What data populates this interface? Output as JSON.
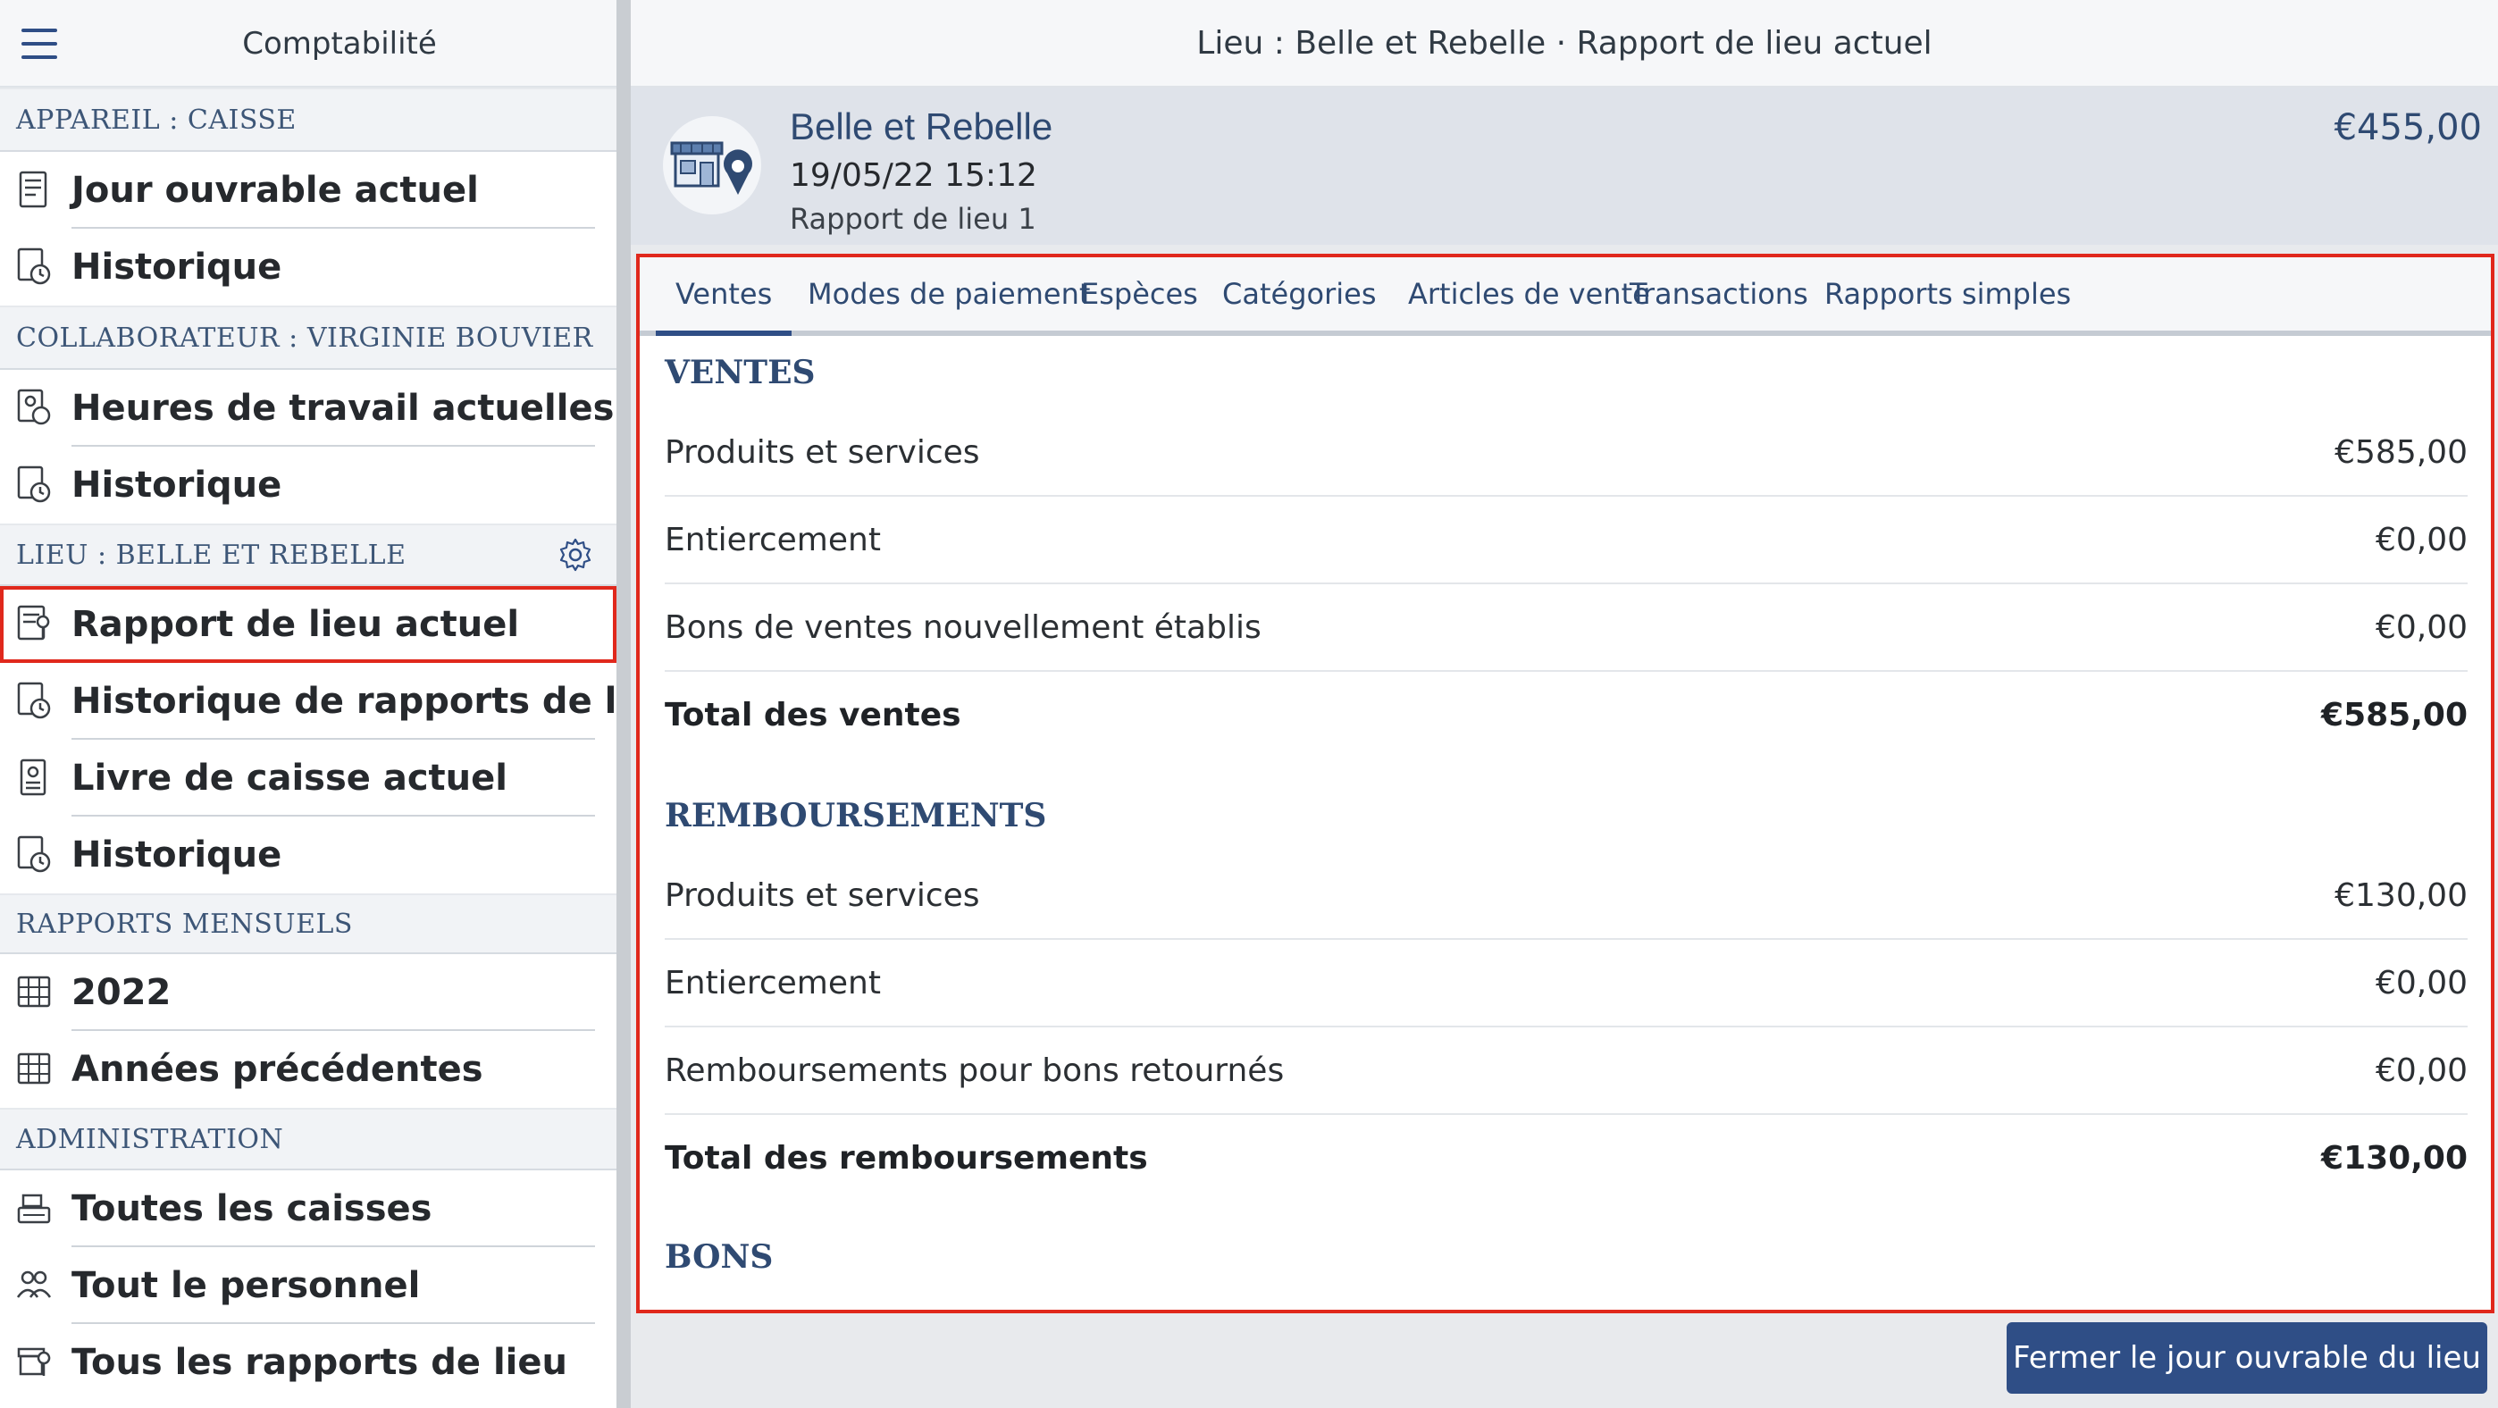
{
  "sidebar": {
    "title": "Comptabilité",
    "sections": [
      {
        "title": "APPAREIL : CAISSE",
        "items": [
          {
            "label": "Jour ouvrable actuel",
            "icon": "receipt-icon"
          },
          {
            "label": "Historique",
            "icon": "history-icon"
          }
        ]
      },
      {
        "title": "COLLABORATEUR : VIRGINIE BOUVIER",
        "items": [
          {
            "label": "Heures de travail actuelles",
            "icon": "work-hours-icon"
          },
          {
            "label": "Historique",
            "icon": "history-icon"
          }
        ]
      },
      {
        "title": "LIEU : BELLE ET REBELLE",
        "items": [
          {
            "label": "Rapport de lieu actuel",
            "icon": "venue-report-icon"
          },
          {
            "label": "Historique de rapports de lieu",
            "icon": "history-icon"
          },
          {
            "label": "Livre de caisse actuel",
            "icon": "cash-book-icon"
          },
          {
            "label": "Historique",
            "icon": "history-icon"
          }
        ]
      },
      {
        "title": "RAPPORTS MENSUELS",
        "items": [
          {
            "label": "2022",
            "icon": "calendar-icon"
          },
          {
            "label": "Années précédentes",
            "icon": "calendar-icon"
          }
        ]
      },
      {
        "title": "ADMINISTRATION",
        "items": [
          {
            "label": "Toutes les caisses",
            "icon": "cash-register-icon"
          },
          {
            "label": "Tout le personnel",
            "icon": "people-icon"
          },
          {
            "label": "Tous les rapports de lieu",
            "icon": "store-location-icon"
          }
        ]
      }
    ]
  },
  "main": {
    "header_title": "Lieu : Belle et Rebelle · Rapport de lieu actuel",
    "venue": {
      "name": "Belle et Rebelle",
      "date": "19/05/22 15:12",
      "report": "Rapport de lieu 1",
      "total": "€455,00"
    },
    "tabs": [
      {
        "label": "Ventes",
        "active": true
      },
      {
        "label": "Modes de paiement",
        "active": false
      },
      {
        "label": "Espèces",
        "active": false
      },
      {
        "label": "Catégories",
        "active": false
      },
      {
        "label": "Articles de vente",
        "active": false
      },
      {
        "label": "Transactions",
        "active": false
      },
      {
        "label": "Rapports simples",
        "active": false
      }
    ],
    "groups": [
      {
        "title": "VENTES",
        "rows": [
          {
            "label": "Produits et services",
            "value": "€585,00"
          },
          {
            "label": "Entiercement",
            "value": "€0,00"
          },
          {
            "label": "Bons de ventes nouvellement établis",
            "value": "€0,00"
          },
          {
            "label": "Total des ventes",
            "value": "€585,00",
            "total": true
          }
        ]
      },
      {
        "title": "REMBOURSEMENTS",
        "rows": [
          {
            "label": "Produits et services",
            "value": "€130,00"
          },
          {
            "label": "Entiercement",
            "value": "€0,00"
          },
          {
            "label": "Remboursements pour bons retournés",
            "value": "€0,00"
          },
          {
            "label": "Total des remboursements",
            "value": "€130,00",
            "total": true
          }
        ]
      },
      {
        "title": "BONS",
        "rows": []
      }
    ],
    "close_button": "Fermer le jour ouvrable du lieu"
  },
  "colors": {
    "accent": "#2f4e86",
    "highlight": "#e0281c",
    "section_text": "#3d5677"
  }
}
